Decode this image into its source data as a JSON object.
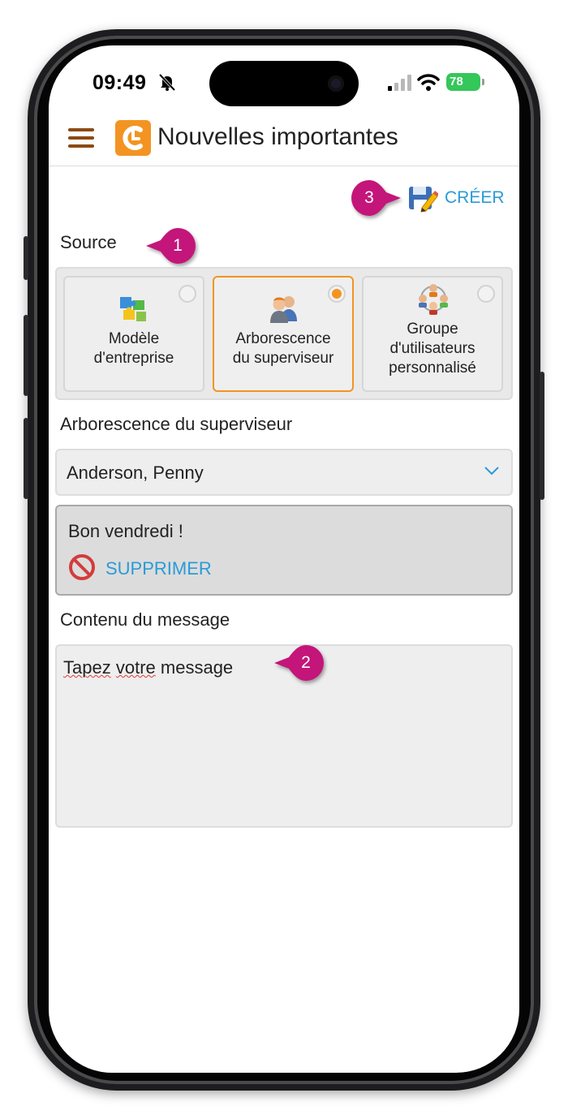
{
  "status_bar": {
    "time": "09:49",
    "battery": "78"
  },
  "header": {
    "title": "Nouvelles importantes",
    "create_label": "CRÉER"
  },
  "source": {
    "label": "Source",
    "options": [
      {
        "label_line1": "Modèle",
        "label_line2": "d'entreprise",
        "selected": false
      },
      {
        "label_line1": "Arborescence",
        "label_line2": "du superviseur",
        "selected": true
      },
      {
        "label_line1": "Groupe",
        "label_line2": "d'utilisateurs",
        "label_line3": "personnalisé",
        "selected": false
      }
    ]
  },
  "tree": {
    "label": "Arborescence du superviseur",
    "selected_value": "Anderson, Penny"
  },
  "message_item": {
    "title": "Bon vendredi !",
    "delete_label": "SUPPRIMER"
  },
  "content": {
    "label": "Contenu du message",
    "placeholder_word1": "Tapez",
    "placeholder_word2": "votre",
    "placeholder_word3": "message"
  },
  "callouts": {
    "one": "1",
    "two": "2",
    "three": "3"
  },
  "colors": {
    "accent": "#f39422",
    "link": "#2a9bd6",
    "callout": "#c4157a"
  }
}
